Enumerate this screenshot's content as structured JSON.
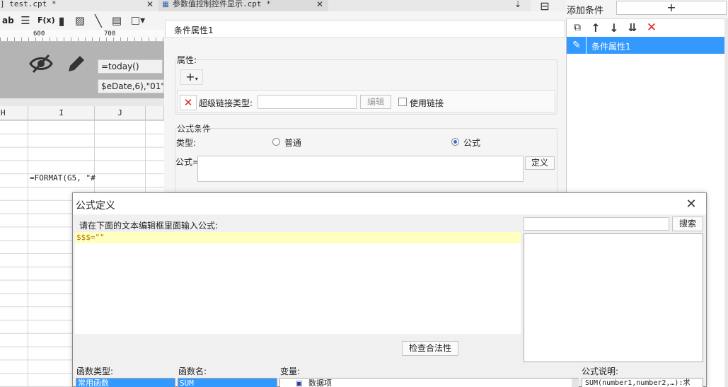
{
  "tabs": {
    "test": "] test.cpt *",
    "param": "参数值控制控件显示.cpt *"
  },
  "toolbar": {
    "ab": "ab",
    "fx": "F(x)"
  },
  "ruler": {
    "mark600": "600",
    "mark700": "700"
  },
  "panel": {
    "formula1": "=today()",
    "formula2": "$eDate,6),\"01\")"
  },
  "sheet": {
    "col_h": "H",
    "col_i": "I",
    "col_j": "J",
    "cell_formula": "=FORMAT(G5, \"#"
  },
  "right": {
    "add_condition": "添加条件",
    "add_plus": "+",
    "list_item": "条件属性1"
  },
  "cond": {
    "title": "条件属性1",
    "attr_label": "属性:",
    "hyperlink_label": "超级链接类型:",
    "edit_button": "编辑",
    "use_link": "使用链接",
    "formula_cond_label": "公式条件",
    "type_label": "类型:",
    "type_normal": "普通",
    "type_formula": "公式",
    "formula_label": "公式=",
    "define_button": "定义"
  },
  "dialog": {
    "title": "公式定义",
    "prompt": "请在下面的文本编辑框里面输入公式:",
    "formula_text": "$$$=\"\"",
    "search_button": "搜索",
    "check_button": "检查合法性",
    "func_type_label": "函数类型:",
    "func_name_label": "函数名:",
    "var_label": "变量:",
    "desc_label": "公式说明:",
    "func_type_selected": "常用函数",
    "func_name_selected": "SUM",
    "var_item": "数据项",
    "desc_text": "SUM(number1,number2,…):求"
  },
  "colors": {
    "selection": "#3399ff",
    "formula_highlight": "#ffffc0",
    "delete_red": "#e02020",
    "sheet_panel_gray": "#b4b4b4"
  }
}
